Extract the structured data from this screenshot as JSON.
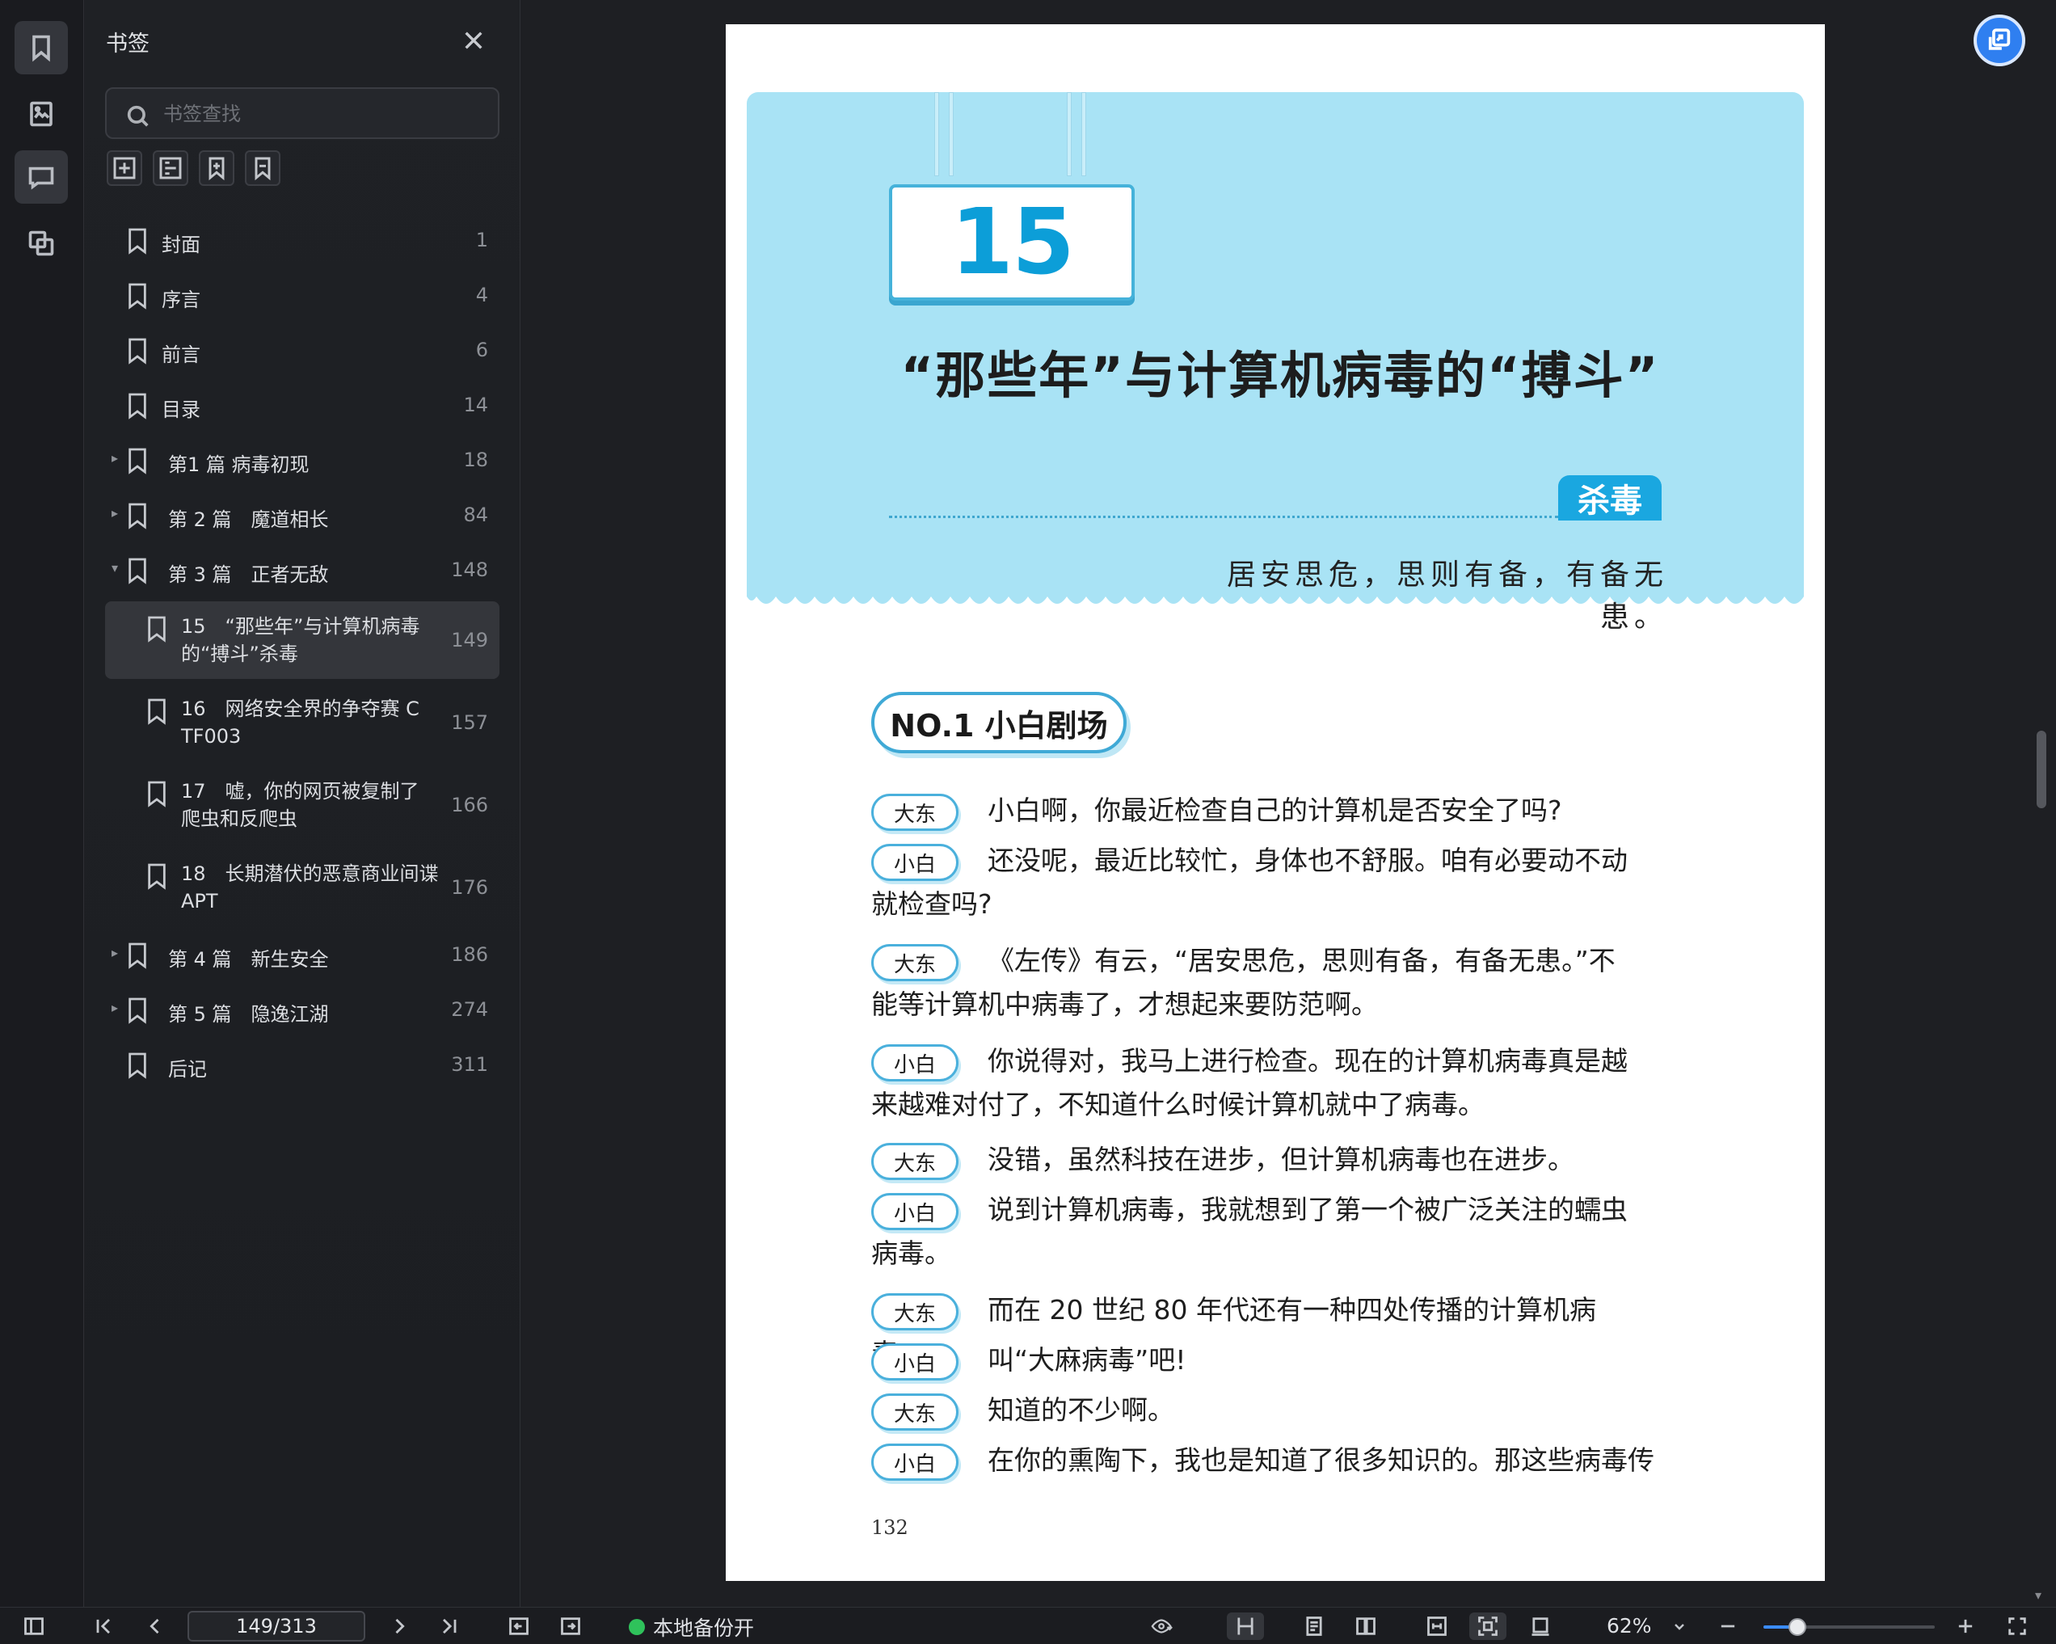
{
  "rail": {
    "items": [
      {
        "name": "bookmark-rail-icon",
        "active": true
      },
      {
        "name": "thumbnail-rail-icon",
        "active": false
      },
      {
        "name": "comment-rail-icon",
        "active": true
      },
      {
        "name": "attachment-rail-icon",
        "active": false
      }
    ]
  },
  "sidebar": {
    "title": "书签",
    "search_placeholder": "书签查找",
    "bookmarks": [
      {
        "label": "封面",
        "page": "1"
      },
      {
        "label": "序言",
        "page": "4"
      },
      {
        "label": "前言",
        "page": "6"
      },
      {
        "label": "目录",
        "page": "14"
      },
      {
        "label": "第1 篇 病毒初现",
        "page": "18",
        "caret": "▸"
      },
      {
        "label": "第 2 篇　魔道相长",
        "page": "84",
        "caret": "▸"
      },
      {
        "label": "第 3 篇　正者无敌",
        "page": "148",
        "caret": "▾"
      },
      {
        "label": "15　“那些年”与计算机病毒的“搏斗”杀毒",
        "page": "149"
      },
      {
        "label": "16　网络安全界的争夺赛 CTF003",
        "page": "157"
      },
      {
        "label": "17　嘘，你的网页被复制了爬虫和反爬虫",
        "page": "166"
      },
      {
        "label": "18　长期潜伏的恶意商业间谍APT",
        "page": "176"
      },
      {
        "label": "第 4 篇　新生安全",
        "page": "186",
        "caret": "▸"
      },
      {
        "label": "第 5 篇　隐逸江湖",
        "page": "274",
        "caret": "▸"
      },
      {
        "label": "后记",
        "page": "311"
      }
    ]
  },
  "document": {
    "chapter_number": "15",
    "chapter_title": "“那些年”与计算机病毒的“搏斗”",
    "tag": "杀毒",
    "motto": "居安思危，思则有备，有备无患。",
    "section": "NO.1 小白剧场",
    "dialogue": [
      {
        "speaker": "大东",
        "text": "小白啊，你最近检查自己的计算机是否安全了吗?"
      },
      {
        "speaker": "小白",
        "text": "还没呢，最近比较忙，身体也不舒服。咱有必要动不动就检查吗?"
      },
      {
        "speaker": "大东",
        "text": "《左传》有云，“居安思危，思则有备，有备无患。”不能等计算机中病毒了，才想起来要防范啊。"
      },
      {
        "speaker": "小白",
        "text": "你说得对，我马上进行检查。现在的计算机病毒真是越来越难对付了，不知道什么时候计算机就中了病毒。"
      },
      {
        "speaker": "大东",
        "text": "没错，虽然科技在进步，但计算机病毒也在进步。"
      },
      {
        "speaker": "小白",
        "text": "说到计算机病毒，我就想到了第一个被广泛关注的蠕虫病毒。"
      },
      {
        "speaker": "大东",
        "text": "而在 20 世纪 80 年代还有一种四处传播的计算机病毒。"
      },
      {
        "speaker": "小白",
        "text": "叫“大麻病毒”吧!"
      },
      {
        "speaker": "大东",
        "text": "知道的不少啊。"
      },
      {
        "speaker": "小白",
        "text": "在你的熏陶下，我也是知道了很多知识的。那这些病毒传"
      }
    ],
    "page_number": "132"
  },
  "toolbar": {
    "page_indicator": "149/313",
    "backup_status": "本地备份开",
    "zoom": "62%",
    "zoom_level": 0.2,
    "accent": "#3b8cff",
    "status_color": "#2fc25b"
  }
}
